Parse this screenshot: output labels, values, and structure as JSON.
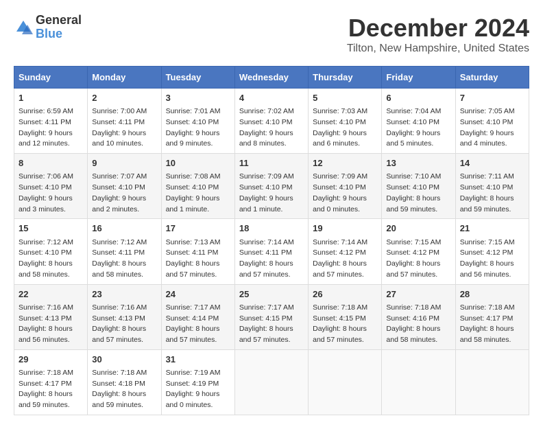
{
  "logo": {
    "general": "General",
    "blue": "Blue"
  },
  "title": "December 2024",
  "location": "Tilton, New Hampshire, United States",
  "days_header": [
    "Sunday",
    "Monday",
    "Tuesday",
    "Wednesday",
    "Thursday",
    "Friday",
    "Saturday"
  ],
  "weeks": [
    [
      {
        "day": "1",
        "info": "Sunrise: 6:59 AM\nSunset: 4:11 PM\nDaylight: 9 hours\nand 12 minutes."
      },
      {
        "day": "2",
        "info": "Sunrise: 7:00 AM\nSunset: 4:11 PM\nDaylight: 9 hours\nand 10 minutes."
      },
      {
        "day": "3",
        "info": "Sunrise: 7:01 AM\nSunset: 4:10 PM\nDaylight: 9 hours\nand 9 minutes."
      },
      {
        "day": "4",
        "info": "Sunrise: 7:02 AM\nSunset: 4:10 PM\nDaylight: 9 hours\nand 8 minutes."
      },
      {
        "day": "5",
        "info": "Sunrise: 7:03 AM\nSunset: 4:10 PM\nDaylight: 9 hours\nand 6 minutes."
      },
      {
        "day": "6",
        "info": "Sunrise: 7:04 AM\nSunset: 4:10 PM\nDaylight: 9 hours\nand 5 minutes."
      },
      {
        "day": "7",
        "info": "Sunrise: 7:05 AM\nSunset: 4:10 PM\nDaylight: 9 hours\nand 4 minutes."
      }
    ],
    [
      {
        "day": "8",
        "info": "Sunrise: 7:06 AM\nSunset: 4:10 PM\nDaylight: 9 hours\nand 3 minutes."
      },
      {
        "day": "9",
        "info": "Sunrise: 7:07 AM\nSunset: 4:10 PM\nDaylight: 9 hours\nand 2 minutes."
      },
      {
        "day": "10",
        "info": "Sunrise: 7:08 AM\nSunset: 4:10 PM\nDaylight: 9 hours\nand 1 minute."
      },
      {
        "day": "11",
        "info": "Sunrise: 7:09 AM\nSunset: 4:10 PM\nDaylight: 9 hours\nand 1 minute."
      },
      {
        "day": "12",
        "info": "Sunrise: 7:09 AM\nSunset: 4:10 PM\nDaylight: 9 hours\nand 0 minutes."
      },
      {
        "day": "13",
        "info": "Sunrise: 7:10 AM\nSunset: 4:10 PM\nDaylight: 8 hours\nand 59 minutes."
      },
      {
        "day": "14",
        "info": "Sunrise: 7:11 AM\nSunset: 4:10 PM\nDaylight: 8 hours\nand 59 minutes."
      }
    ],
    [
      {
        "day": "15",
        "info": "Sunrise: 7:12 AM\nSunset: 4:10 PM\nDaylight: 8 hours\nand 58 minutes."
      },
      {
        "day": "16",
        "info": "Sunrise: 7:12 AM\nSunset: 4:11 PM\nDaylight: 8 hours\nand 58 minutes."
      },
      {
        "day": "17",
        "info": "Sunrise: 7:13 AM\nSunset: 4:11 PM\nDaylight: 8 hours\nand 57 minutes."
      },
      {
        "day": "18",
        "info": "Sunrise: 7:14 AM\nSunset: 4:11 PM\nDaylight: 8 hours\nand 57 minutes."
      },
      {
        "day": "19",
        "info": "Sunrise: 7:14 AM\nSunset: 4:12 PM\nDaylight: 8 hours\nand 57 minutes."
      },
      {
        "day": "20",
        "info": "Sunrise: 7:15 AM\nSunset: 4:12 PM\nDaylight: 8 hours\nand 57 minutes."
      },
      {
        "day": "21",
        "info": "Sunrise: 7:15 AM\nSunset: 4:12 PM\nDaylight: 8 hours\nand 56 minutes."
      }
    ],
    [
      {
        "day": "22",
        "info": "Sunrise: 7:16 AM\nSunset: 4:13 PM\nDaylight: 8 hours\nand 56 minutes."
      },
      {
        "day": "23",
        "info": "Sunrise: 7:16 AM\nSunset: 4:13 PM\nDaylight: 8 hours\nand 57 minutes."
      },
      {
        "day": "24",
        "info": "Sunrise: 7:17 AM\nSunset: 4:14 PM\nDaylight: 8 hours\nand 57 minutes."
      },
      {
        "day": "25",
        "info": "Sunrise: 7:17 AM\nSunset: 4:15 PM\nDaylight: 8 hours\nand 57 minutes."
      },
      {
        "day": "26",
        "info": "Sunrise: 7:18 AM\nSunset: 4:15 PM\nDaylight: 8 hours\nand 57 minutes."
      },
      {
        "day": "27",
        "info": "Sunrise: 7:18 AM\nSunset: 4:16 PM\nDaylight: 8 hours\nand 58 minutes."
      },
      {
        "day": "28",
        "info": "Sunrise: 7:18 AM\nSunset: 4:17 PM\nDaylight: 8 hours\nand 58 minutes."
      }
    ],
    [
      {
        "day": "29",
        "info": "Sunrise: 7:18 AM\nSunset: 4:17 PM\nDaylight: 8 hours\nand 59 minutes."
      },
      {
        "day": "30",
        "info": "Sunrise: 7:18 AM\nSunset: 4:18 PM\nDaylight: 8 hours\nand 59 minutes."
      },
      {
        "day": "31",
        "info": "Sunrise: 7:19 AM\nSunset: 4:19 PM\nDaylight: 9 hours\nand 0 minutes."
      },
      {
        "day": "",
        "info": ""
      },
      {
        "day": "",
        "info": ""
      },
      {
        "day": "",
        "info": ""
      },
      {
        "day": "",
        "info": ""
      }
    ]
  ]
}
